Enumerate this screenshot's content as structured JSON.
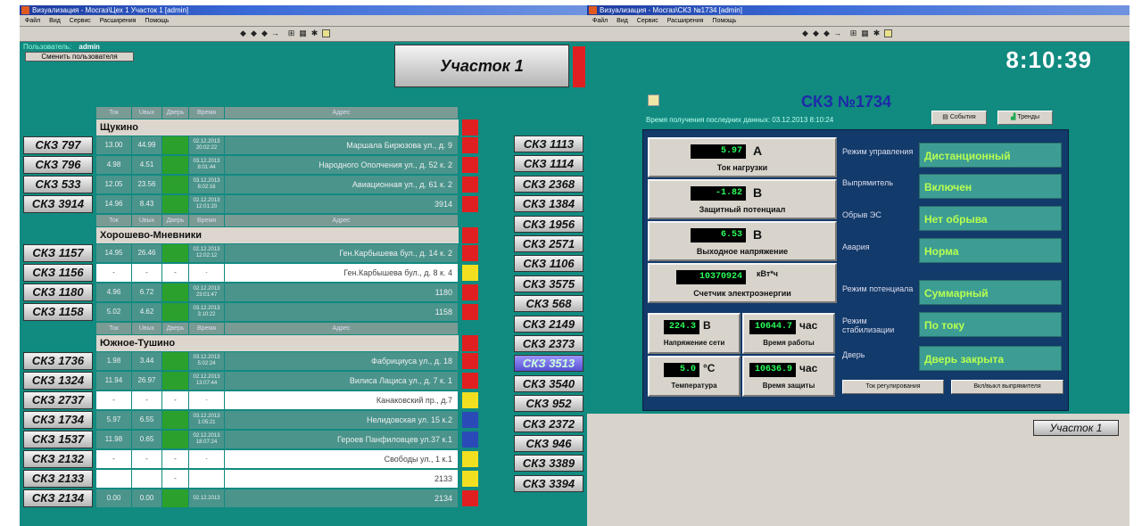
{
  "left_window": {
    "title": "Визуализация - Мосгаз\\Цех 1 Участок 1 [admin]",
    "menu": [
      "Файл",
      "Вид",
      "Сервис",
      "Расширения",
      "Помощь"
    ],
    "user_label": "Пользователь:",
    "user_name": "admin",
    "change_user_label": "Сменить пользователя",
    "section_button_label": "Участок 1",
    "table_headers": [
      "Ток нагрузки",
      "Uвых",
      "Дверь",
      "Время связи",
      "Адрес"
    ],
    "districts": [
      {
        "name": "Щукино",
        "rows": [
          {
            "label": "СКЗ 797",
            "current": "13.00",
            "uout": "44.99",
            "door_color": "#2ca02c",
            "time": "02.12.2013 20:02:22",
            "address": "Маршала Бирюзова ул., д. 9",
            "status_color": "#e02020"
          },
          {
            "label": "СКЗ 796",
            "current": "4.98",
            "uout": "4.51",
            "door_color": "#2ca02c",
            "time": "03.12.2013 8:01:44",
            "address": "Народного Ополчения ул., д. 52 к. 2",
            "status_color": "#e02020"
          },
          {
            "label": "СКЗ 533",
            "current": "12.05",
            "uout": "23.56",
            "door_color": "#2ca02c",
            "time": "03.12.2013 8:02:16",
            "address": "Авиационная ул., д. 61 к. 2",
            "status_color": "#e02020"
          },
          {
            "label": "СКЗ 3914",
            "current": "14.96",
            "uout": "8.43",
            "door_color": "#2ca02c",
            "time": "02.12.2013 12:01:20",
            "address": "3914",
            "status_color": "#e02020"
          }
        ]
      },
      {
        "name": "Хорошево-Мневники",
        "rows": [
          {
            "label": "СКЗ 1157",
            "current": "14.95",
            "uout": "26.46",
            "door_color": "#2ca02c",
            "time": "02.12.2013 12:02:12",
            "address": "Ген.Карбышева бул., д. 14 к. 2",
            "status_color": "#e02020"
          },
          {
            "label": "СКЗ 1156",
            "current": "-",
            "uout": "-",
            "door_color": "",
            "time": "-",
            "address": "Ген.Карбышева бул., д. 8 к. 4",
            "status_color": "#f2e020",
            "empty": true
          },
          {
            "label": "СКЗ 1180",
            "current": "4.96",
            "uout": "6.72",
            "door_color": "#2ca02c",
            "time": "02.12.2013 23:01:47",
            "address": "1180",
            "status_color": "#e02020"
          },
          {
            "label": "СКЗ 1158",
            "current": "5.02",
            "uout": "4.62",
            "door_color": "#2ca02c",
            "time": "03.12.2013 3:10:22",
            "address": "1158",
            "status_color": "#e02020"
          }
        ]
      },
      {
        "name": "Южное-Тушино",
        "rows": [
          {
            "label": "СКЗ 1736",
            "current": "1.98",
            "uout": "3.44",
            "door_color": "#2ca02c",
            "time": "03.12.2013 5:02:24",
            "address": "Фабрициуса ул., д. 18",
            "status_color": "#e02020"
          },
          {
            "label": "СКЗ 1324",
            "current": "11.94",
            "uout": "26.97",
            "door_color": "#2ca02c",
            "time": "02.12.2013 13:07:44",
            "address": "Вилиса Лациса ул., д. 7 к. 1",
            "status_color": "#e02020"
          },
          {
            "label": "СКЗ 2737",
            "current": "-",
            "uout": "-",
            "door_color": "",
            "time": "-",
            "address": "Канаковский пр., д.7",
            "status_color": "#f2e020",
            "empty": true
          },
          {
            "label": "СКЗ 1734",
            "current": "5.97",
            "uout": "6.55",
            "door_color": "#2ca02c",
            "time": "03.12.2013 1:05:21",
            "address": "Нелидовская ул. 15 к.2",
            "status_color": "#2a4ab8"
          },
          {
            "label": "СКЗ 1537",
            "current": "11.98",
            "uout": "0.65",
            "door_color": "#2ca02c",
            "time": "02.12.2013 18:07:24",
            "address": "Героев Панфиловцев ул.37 к.1",
            "status_color": "#2a4ab8"
          },
          {
            "label": "СКЗ 2132",
            "current": "-",
            "uout": "-",
            "door_color": "",
            "time": "-",
            "address": "Свободы ул., 1 к.1",
            "status_color": "#f2e020",
            "empty": true
          },
          {
            "label": "СКЗ 2133",
            "current": "",
            "uout": "",
            "door_color": "",
            "time": "",
            "address": "2133",
            "status_color": "#f2e020",
            "empty": true
          },
          {
            "label": "СКЗ 2134",
            "current": "0.00",
            "uout": "0.00",
            "door_color": "#2ca02c",
            "time": "02.12.2013",
            "address": "2134",
            "status_color": "#e02020"
          }
        ]
      }
    ],
    "right_list": [
      "СКЗ 1113",
      "СКЗ 1114",
      "СКЗ 2368",
      "СКЗ 1384",
      "СКЗ 1956",
      "СКЗ 2571",
      "СКЗ 1106",
      "СКЗ 3575",
      "СКЗ 568",
      "СКЗ 2149",
      "СКЗ 2373",
      "СКЗ 3513",
      "СКЗ 3540",
      "СКЗ 952",
      "СКЗ 2372",
      "СКЗ 946",
      "СКЗ 3389",
      "СКЗ 3394"
    ],
    "right_list_selected": "СКЗ 3513"
  },
  "right_window": {
    "title": "Визуализация - Мосгаз\\СКЗ №1734 [admin]",
    "menu": [
      "Файл",
      "Вид",
      "Сервис",
      "Расширения",
      "Помощь"
    ],
    "clock": "8:10:39",
    "station_title": "СКЗ №1734",
    "last_data_label": "Время получения последних данных: 03.12.2013 8:10:24",
    "events_button": "События",
    "trends_button": "Тренды",
    "measures": [
      {
        "value": "5.97",
        "unit": "А",
        "label": "Ток нагрузки"
      },
      {
        "value": "-1.82",
        "unit": "В",
        "label": "Защитный потенциал"
      },
      {
        "value": "6.53",
        "unit": "В",
        "label": "Выходное напряжение"
      },
      {
        "value": "10370924",
        "unit": "кВт*ч",
        "label": "Счетчик электроэнергии"
      }
    ],
    "small_measures": [
      {
        "value": "224.3",
        "unit": "В",
        "label": "Напряжение сети"
      },
      {
        "value": "10644.7",
        "unit": "час",
        "label": "Время работы"
      },
      {
        "value": "5.0",
        "unit": "°С",
        "label": "Температура"
      },
      {
        "value": "10636.9",
        "unit": "час",
        "label": "Время защиты"
      }
    ],
    "status": [
      {
        "label": "Режим управления",
        "value": "Дистанционный"
      },
      {
        "label": "Выпрямитель",
        "value": "Включен"
      },
      {
        "label": "Обрыв ЭС",
        "value": "Нет обрыва"
      },
      {
        "label": "Авария",
        "value": "Норма"
      },
      {
        "label": "Режим потенциала",
        "value": "Суммарный"
      },
      {
        "label": "Режим стабилизации",
        "value": "По току"
      },
      {
        "label": "Дверь",
        "value": "Дверь закрыта"
      }
    ],
    "reg_current_button": "Ток регулирования",
    "rectifier_toggle_button": "Вкл/выкл выпрямителя",
    "section_link": "Участок 1"
  }
}
